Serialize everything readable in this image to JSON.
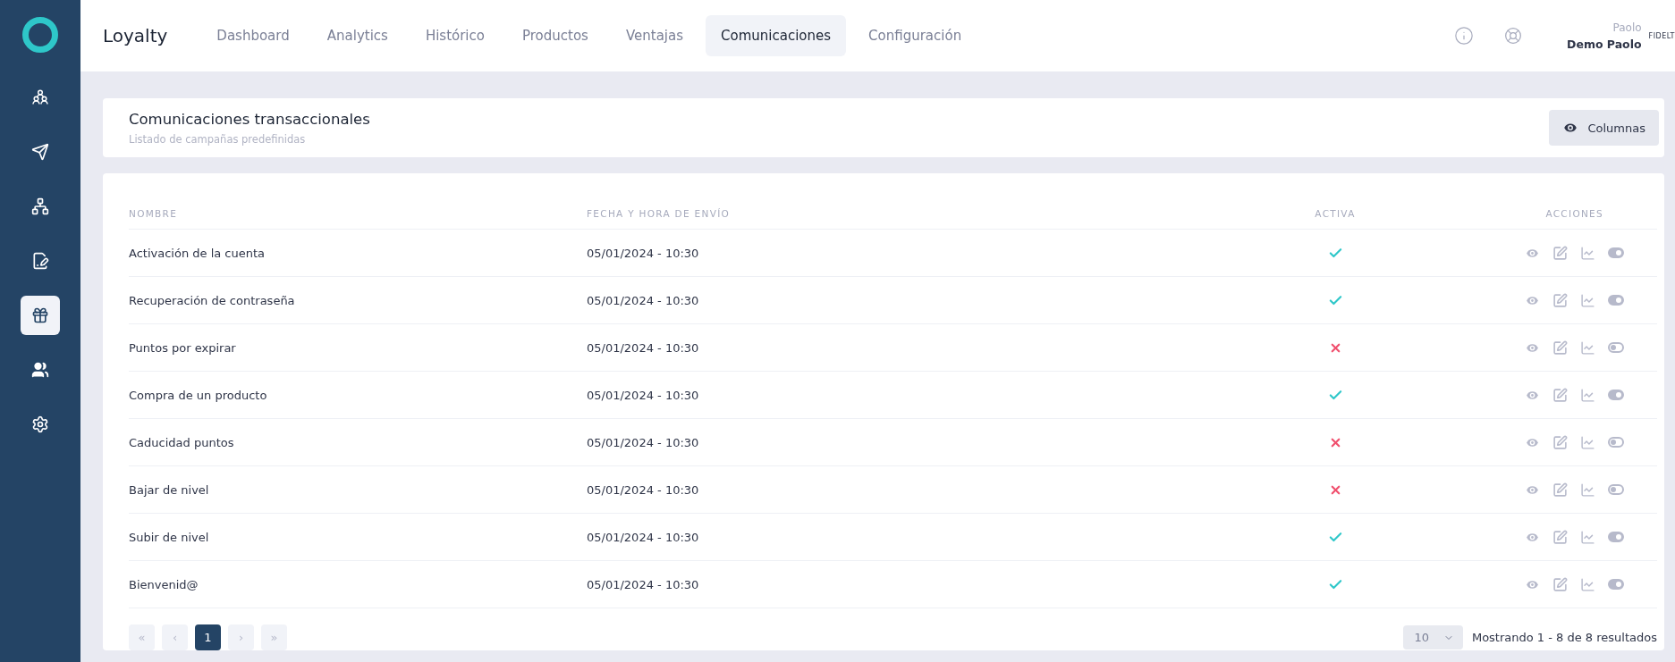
{
  "sidebar": {
    "items": [
      {
        "selected": false
      },
      {
        "selected": false
      },
      {
        "selected": false
      },
      {
        "selected": false
      },
      {
        "selected": true
      },
      {
        "selected": false
      },
      {
        "selected": false
      }
    ]
  },
  "header": {
    "brand": "Loyalty",
    "tabs": [
      {
        "label": "Dashboard",
        "selected": false
      },
      {
        "label": "Analytics",
        "selected": false
      },
      {
        "label": "Histórico",
        "selected": false
      },
      {
        "label": "Productos",
        "selected": false
      },
      {
        "label": "Ventajas",
        "selected": false
      },
      {
        "label": "Comunicaciones",
        "selected": true
      },
      {
        "label": "Configuración",
        "selected": false
      }
    ],
    "user": {
      "first_name": "Paolo",
      "full_name": "Demo Paolo",
      "tag": "FIDELT"
    }
  },
  "title_card": {
    "title": "Comunicaciones transaccionales",
    "subtitle": "Listado de campañas predefinidas",
    "button": "Columnas"
  },
  "table": {
    "columns": [
      "NOMBRE",
      "FECHA Y HORA DE ENVÍO",
      "ACTIVA",
      "ACCIONES"
    ],
    "rows": [
      {
        "name": "Activación de la cuenta",
        "date": "05/01/2024 - 10:30",
        "active": true,
        "enabled": true
      },
      {
        "name": "Recuperación de contraseña",
        "date": "05/01/2024 - 10:30",
        "active": true,
        "enabled": true
      },
      {
        "name": "Puntos por expirar",
        "date": "05/01/2024 - 10:30",
        "active": false,
        "enabled": false
      },
      {
        "name": "Compra de un producto",
        "date": "05/01/2024 - 10:30",
        "active": true,
        "enabled": true
      },
      {
        "name": "Caducidad puntos",
        "date": "05/01/2024 - 10:30",
        "active": false,
        "enabled": false
      },
      {
        "name": "Bajar de nivel",
        "date": "05/01/2024 - 10:30",
        "active": false,
        "enabled": false
      },
      {
        "name": "Subir de nivel",
        "date": "05/01/2024 - 10:30",
        "active": true,
        "enabled": true
      },
      {
        "name": "Bienvenid@",
        "date": "05/01/2024 - 10:30",
        "active": true,
        "enabled": true
      }
    ]
  },
  "pagination": {
    "buttons": [
      {
        "label": "«",
        "selected": false
      },
      {
        "label": "‹",
        "selected": false
      },
      {
        "label": "1",
        "selected": true
      },
      {
        "label": "›",
        "selected": false
      },
      {
        "label": "»",
        "selected": false
      }
    ],
    "page_size": "10",
    "summary": "Mostrando 1 - 8 de 8 resultados"
  }
}
